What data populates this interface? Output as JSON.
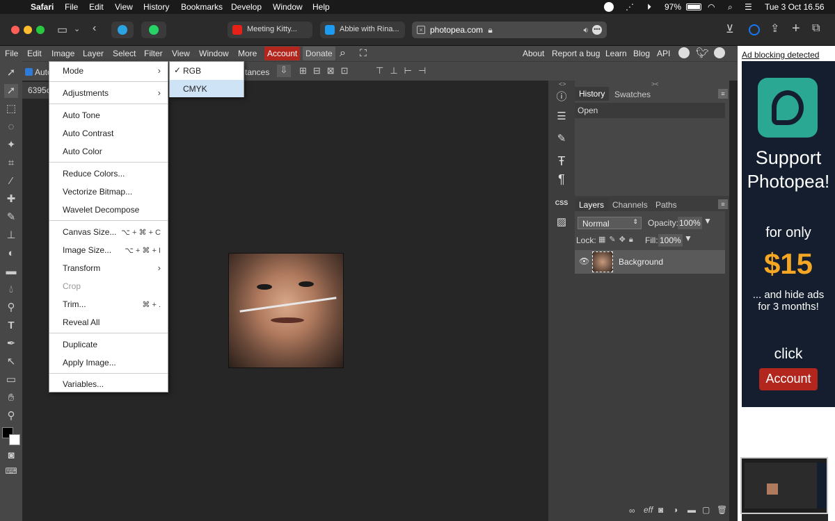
{
  "mac_menubar": {
    "items": [
      "Safari",
      "File",
      "Edit",
      "View",
      "History",
      "Bookmarks",
      "Develop",
      "Window",
      "Help"
    ],
    "battery": "97%",
    "datetime": "Tue 3 Oct  16.56"
  },
  "safari": {
    "tabs": [
      {
        "title": "Meeting Kitty..."
      },
      {
        "title": "Abbie with Rina..."
      }
    ],
    "url": "photopea.com"
  },
  "pp_menu": {
    "items": [
      "File",
      "Edit",
      "Image",
      "Layer",
      "Select",
      "Filter",
      "View",
      "Window",
      "More"
    ],
    "account": "Account",
    "donate": "Donate",
    "right_links": [
      "About",
      "Report a bug",
      "Learn",
      "Blog",
      "API"
    ]
  },
  "options_bar": {
    "auto_select": "Auto",
    "distances": "tances"
  },
  "document": {
    "tab_title": "6395c"
  },
  "image_menu": {
    "items": [
      {
        "label": "Mode",
        "submenu": true
      },
      {
        "label": "Adjustments",
        "submenu": true
      },
      {
        "label": "Auto Tone"
      },
      {
        "label": "Auto Contrast"
      },
      {
        "label": "Auto Color"
      },
      {
        "label": "Reduce Colors..."
      },
      {
        "label": "Vectorize Bitmap..."
      },
      {
        "label": "Wavelet Decompose"
      },
      {
        "label": "Canvas Size...",
        "shortcut": "⌥ + ⌘ + C"
      },
      {
        "label": "Image Size...",
        "shortcut": "⌥ + ⌘ + I"
      },
      {
        "label": "Transform",
        "submenu": true
      },
      {
        "label": "Crop",
        "disabled": true
      },
      {
        "label": "Trim...",
        "shortcut": "⌘ + ."
      },
      {
        "label": "Reveal All"
      },
      {
        "label": "Duplicate"
      },
      {
        "label": "Apply Image..."
      },
      {
        "label": "Variables..."
      }
    ]
  },
  "mode_submenu": {
    "items": [
      {
        "label": "RGB",
        "checked": true
      },
      {
        "label": "CMYK",
        "highlighted": true
      }
    ]
  },
  "history_panel": {
    "tabs": [
      "History",
      "Swatches"
    ],
    "entries": [
      "Open"
    ]
  },
  "layers_panel": {
    "tabs": [
      "Layers",
      "Channels",
      "Paths"
    ],
    "blend_mode": "Normal",
    "opacity_label": "Opacity:",
    "opacity": "100%",
    "lock_label": "Lock:",
    "fill_label": "Fill:",
    "fill": "100%",
    "layers": [
      {
        "name": "Background"
      }
    ],
    "footer_icons": [
      "link-icon",
      "effects-icon",
      "mask-icon",
      "adjustment-icon",
      "folder-icon",
      "new-layer-icon",
      "trash-icon"
    ]
  },
  "ad": {
    "notice": "Ad blocking detected",
    "headline_1": "Support",
    "headline_2": "Photopea!",
    "for_only": "for only",
    "price": "$15",
    "hide_1": "... and hide ads",
    "hide_2": "for 3 months!",
    "click": "click",
    "button": "Account"
  },
  "colors": {
    "accent_red": "#b3261e",
    "menu_highlight": "#cfe3f7",
    "ad_teal": "#2ba893",
    "price_orange": "#f5a623"
  }
}
